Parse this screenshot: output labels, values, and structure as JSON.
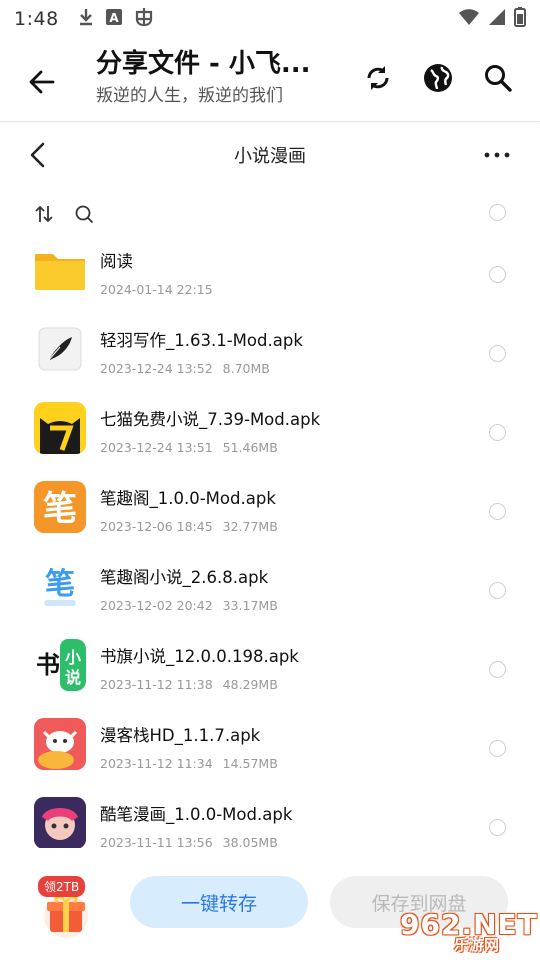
{
  "status_bar": {
    "time": "1:48",
    "icons": [
      "download-icon",
      "a-notification-icon",
      "bug-notification-icon",
      "wifi-icon",
      "signal-icon",
      "battery-icon"
    ]
  },
  "app_bar": {
    "title": "分享文件 - 小飞...",
    "subtitle": "叛逆的人生，叛逆的我们",
    "icons": [
      "back-arrow-icon",
      "refresh-icon",
      "globe-icon",
      "search-icon"
    ]
  },
  "folder": {
    "title": "小说漫画",
    "more_icon": "more-icon"
  },
  "files": [
    {
      "name": "阅读",
      "date": "2024-01-14 22:15",
      "size": "",
      "icon": "folder-icon",
      "color": "#FBC02D"
    },
    {
      "name": "轻羽写作_1.63.1-Mod.apk",
      "date": "2023-12-24 13:52",
      "size": "8.70MB",
      "icon": "feather-app-icon",
      "color": "#ECECEC"
    },
    {
      "name": "七猫免费小说_7.39-Mod.apk",
      "date": "2023-12-24 13:51",
      "size": "51.46MB",
      "icon": "black-cat-app-icon",
      "color": "#FFD11A"
    },
    {
      "name": "笔趣阁_1.0.0-Mod.apk",
      "date": "2023-12-06 18:45",
      "size": "32.77MB",
      "icon": "biquge-app-icon",
      "color": "#F4962A"
    },
    {
      "name": "笔趣阁小说_2.6.8.apk",
      "date": "2023-12-02 20:42",
      "size": "33.17MB",
      "icon": "biquge-novel-app-icon",
      "color": "#3C9CF0"
    },
    {
      "name": "书旗小说_12.0.0.198.apk",
      "date": "2023-11-12 11:38",
      "size": "48.29MB",
      "icon": "shuqi-app-icon",
      "color": "#2DBE6C"
    },
    {
      "name": "漫客栈HD_1.1.7.apk",
      "date": "2023-11-12 11:34",
      "size": "14.57MB",
      "icon": "mankezhan-app-icon",
      "color": "#F05A5A"
    },
    {
      "name": "酷笔漫画_1.0.0-Mod.apk",
      "date": "2023-11-11 13:56",
      "size": "38.05MB",
      "icon": "kubi-app-icon",
      "color": "#6A4FC7"
    }
  ],
  "icon_glyphs": {
    "feather": "✒",
    "cat": "7",
    "biquge": "笔",
    "shuqi_left": "书",
    "shuqi_right": "小说"
  },
  "bottom": {
    "gift_badge": "领2TB",
    "transfer_label": "一键转存",
    "save_label": "保存到网盘",
    "watermark_num": "962.NET",
    "watermark_sub": "乐游网",
    "accent": "#2B78E4"
  }
}
